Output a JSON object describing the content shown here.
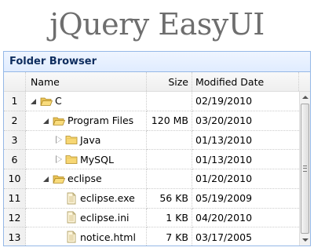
{
  "banner": {
    "title": "jQuery EasyUI"
  },
  "panel": {
    "title": "Folder Browser"
  },
  "columns": {
    "name": "Name",
    "size": "Size",
    "date": "Modified Date"
  },
  "rows": [
    {
      "num": "1",
      "name": "C",
      "size": "",
      "date": "02/19/2010",
      "level": 0,
      "type": "folder",
      "state": "open"
    },
    {
      "num": "2",
      "name": "Program Files",
      "size": "120 MB",
      "date": "03/20/2010",
      "level": 1,
      "type": "folder",
      "state": "open"
    },
    {
      "num": "3",
      "name": "Java",
      "size": "",
      "date": "01/13/2010",
      "level": 2,
      "type": "folder",
      "state": "closed"
    },
    {
      "num": "6",
      "name": "MySQL",
      "size": "",
      "date": "01/13/2010",
      "level": 2,
      "type": "folder",
      "state": "closed"
    },
    {
      "num": "10",
      "name": "eclipse",
      "size": "",
      "date": "01/20/2010",
      "level": 1,
      "type": "folder",
      "state": "open"
    },
    {
      "num": "11",
      "name": "eclipse.exe",
      "size": "56 KB",
      "date": "05/19/2009",
      "level": 2,
      "type": "file",
      "state": ""
    },
    {
      "num": "12",
      "name": "eclipse.ini",
      "size": "1 KB",
      "date": "04/20/2010",
      "level": 2,
      "type": "file",
      "state": ""
    },
    {
      "num": "13",
      "name": "notice.html",
      "size": "7 KB",
      "date": "03/17/2005",
      "level": 2,
      "type": "file",
      "state": ""
    }
  ],
  "colors": {
    "panel_border": "#95b8e7",
    "header_text": "#0e2d5f",
    "folder": "#f7d774",
    "banner": "#6e6e6e"
  },
  "icons": {
    "folder": "folder-icon",
    "file": "file-icon",
    "expanded": "expanded-arrow-icon",
    "collapsed": "collapsed-arrow-icon"
  }
}
